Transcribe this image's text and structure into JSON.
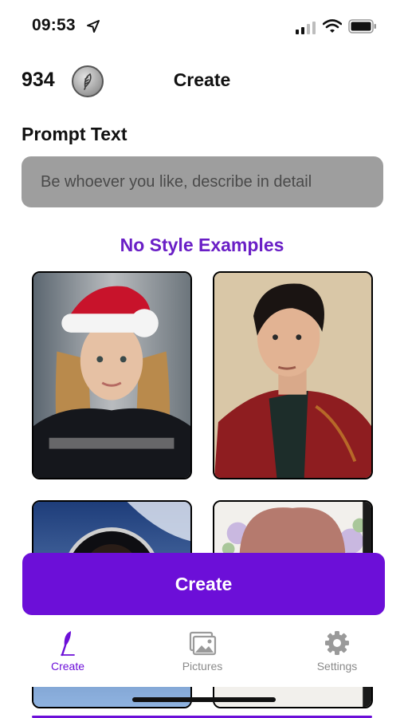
{
  "status_bar": {
    "time": "09:53",
    "icons": [
      "location-arrow-icon",
      "cellular-signal-icon",
      "wifi-icon",
      "battery-icon"
    ]
  },
  "header": {
    "credits": "934",
    "coin_icon": "feather-coin-icon",
    "title": "Create"
  },
  "prompt": {
    "label": "Prompt Text",
    "placeholder": "Be whoever you like, describe in detail",
    "value": ""
  },
  "examples": {
    "heading": "No Style Examples",
    "items": [
      {
        "icon": "woman-santa-hat-portrait"
      },
      {
        "icon": "man-red-robe-portrait"
      },
      {
        "icon": "astronaut-portrait"
      },
      {
        "icon": "woman-bangs-portrait"
      }
    ]
  },
  "create_button": {
    "label": "Create"
  },
  "tab_bar": {
    "tabs": [
      {
        "label": "Create",
        "icon": "feather-icon",
        "active": true
      },
      {
        "label": "Pictures",
        "icon": "pictures-icon",
        "active": false
      },
      {
        "label": "Settings",
        "icon": "gear-icon",
        "active": false
      }
    ]
  },
  "colors": {
    "accent": "#6c0fd8",
    "heading_purple": "#6a1fc6",
    "input_background": "#9e9e9e",
    "inactive_tab": "#8a8a8a"
  }
}
